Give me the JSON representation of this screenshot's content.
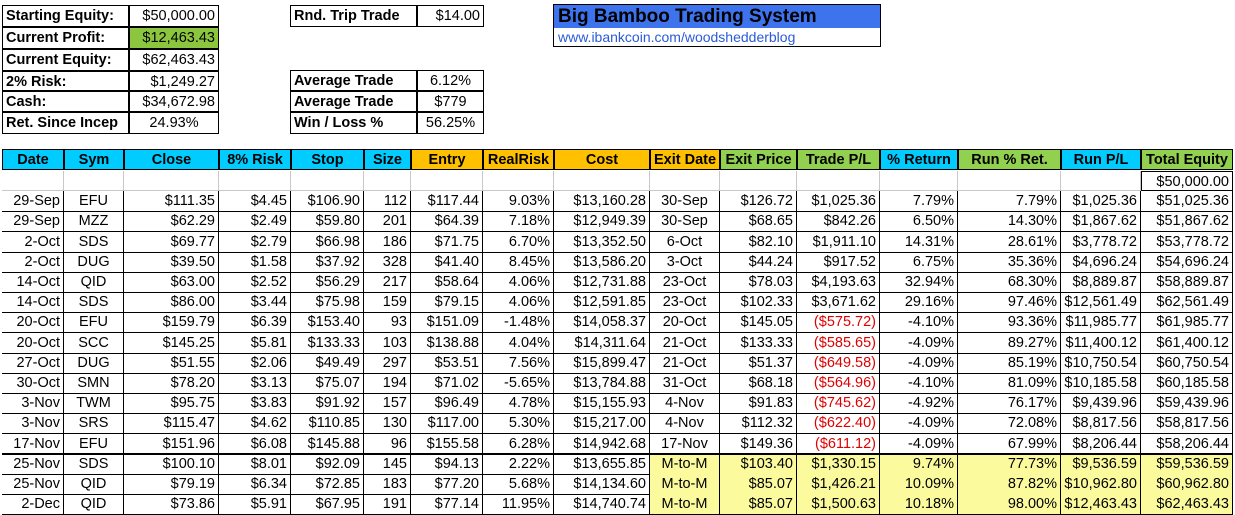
{
  "title": {
    "heading": "Big Bamboo Trading System",
    "link": "www.ibankcoin.com/woodshedderblog"
  },
  "summary": {
    "starting_equity": {
      "label": "Starting Equity:",
      "value": "$50,000.00"
    },
    "current_profit": {
      "label": "Current Profit:",
      "value": "$12,463.43"
    },
    "current_equity": {
      "label": "Current Equity:",
      "value": "$62,463.43"
    },
    "risk_2pct": {
      "label": "2% Risk:",
      "value": "$1,249.27"
    },
    "cash": {
      "label": "Cash:",
      "value": "$34,672.98"
    },
    "ret_since_incep": {
      "label": "Ret. Since Incep",
      "value": "24.93%"
    },
    "rnd_trip_trade": {
      "label": "Rnd. Trip Trade",
      "value": "$14.00"
    },
    "avg_trade_pct": {
      "label": "Average Trade",
      "value": "6.12%"
    },
    "avg_trade_usd": {
      "label": "Average Trade",
      "value": "$779"
    },
    "win_loss": {
      "label": "Win / Loss %",
      "value": "56.25%"
    }
  },
  "columns": [
    "Date",
    "Sym",
    "Close",
    "8% Risk",
    "Stop",
    "Size",
    "Entry",
    "RealRisk",
    "Cost",
    "Exit Date",
    "Exit Price",
    "Trade P/L",
    "% Return",
    "Run % Ret.",
    "Run P/L",
    "Total Equity"
  ],
  "starting_total_equity": "$50,000.00",
  "rows": [
    [
      "29-Sep",
      "EFU",
      "$111.35",
      "$4.45",
      "$106.90",
      "112",
      "$117.44",
      "9.03%",
      "$13,160.28",
      "30-Sep",
      "$126.72",
      "$1,025.36",
      "7.79%",
      "7.79%",
      "$1,025.36",
      "$51,025.36"
    ],
    [
      "29-Sep",
      "MZZ",
      "$62.29",
      "$2.49",
      "$59.80",
      "201",
      "$64.39",
      "7.18%",
      "$12,949.39",
      "30-Sep",
      "$68.65",
      "$842.26",
      "6.50%",
      "14.30%",
      "$1,867.62",
      "$51,867.62"
    ],
    [
      "2-Oct",
      "SDS",
      "$69.77",
      "$2.79",
      "$66.98",
      "186",
      "$71.75",
      "6.70%",
      "$13,352.50",
      "6-Oct",
      "$82.10",
      "$1,911.10",
      "14.31%",
      "28.61%",
      "$3,778.72",
      "$53,778.72"
    ],
    [
      "2-Oct",
      "DUG",
      "$39.50",
      "$1.58",
      "$37.92",
      "328",
      "$41.40",
      "8.45%",
      "$13,586.20",
      "3-Oct",
      "$44.24",
      "$917.52",
      "6.75%",
      "35.36%",
      "$4,696.24",
      "$54,696.24"
    ],
    [
      "14-Oct",
      "QID",
      "$63.00",
      "$2.52",
      "$56.29",
      "217",
      "$58.64",
      "4.06%",
      "$12,731.88",
      "23-Oct",
      "$78.03",
      "$4,193.63",
      "32.94%",
      "68.30%",
      "$8,889.87",
      "$58,889.87"
    ],
    [
      "14-Oct",
      "SDS",
      "$86.00",
      "$3.44",
      "$75.98",
      "159",
      "$79.15",
      "4.06%",
      "$12,591.85",
      "23-Oct",
      "$102.33",
      "$3,671.62",
      "29.16%",
      "97.46%",
      "$12,561.49",
      "$62,561.49"
    ],
    [
      "20-Oct",
      "EFU",
      "$159.79",
      "$6.39",
      "$153.40",
      "93",
      "$151.09",
      "-1.48%",
      "$14,058.37",
      "20-Oct",
      "$145.05",
      "($575.72)",
      "-4.10%",
      "93.36%",
      "$11,985.77",
      "$61,985.77"
    ],
    [
      "20-Oct",
      "SCC",
      "$145.25",
      "$5.81",
      "$133.33",
      "103",
      "$138.88",
      "4.04%",
      "$14,311.64",
      "21-Oct",
      "$133.33",
      "($585.65)",
      "-4.09%",
      "89.27%",
      "$11,400.12",
      "$61,400.12"
    ],
    [
      "27-Oct",
      "DUG",
      "$51.55",
      "$2.06",
      "$49.49",
      "297",
      "$53.51",
      "7.56%",
      "$15,899.47",
      "21-Oct",
      "$51.37",
      "($649.58)",
      "-4.09%",
      "85.19%",
      "$10,750.54",
      "$60,750.54"
    ],
    [
      "30-Oct",
      "SMN",
      "$78.20",
      "$3.13",
      "$75.07",
      "194",
      "$71.02",
      "-5.65%",
      "$13,784.88",
      "31-Oct",
      "$68.18",
      "($564.96)",
      "-4.10%",
      "81.09%",
      "$10,185.58",
      "$60,185.58"
    ],
    [
      "3-Nov",
      "TWM",
      "$95.75",
      "$3.83",
      "$91.92",
      "157",
      "$96.49",
      "4.78%",
      "$15,155.93",
      "4-Nov",
      "$91.83",
      "($745.62)",
      "-4.92%",
      "76.17%",
      "$9,439.96",
      "$59,439.96"
    ],
    [
      "3-Nov",
      "SRS",
      "$115.47",
      "$4.62",
      "$110.85",
      "130",
      "$117.00",
      "5.30%",
      "$15,217.00",
      "4-Nov",
      "$112.32",
      "($622.40)",
      "-4.09%",
      "72.08%",
      "$8,817.56",
      "$58,817.56"
    ],
    [
      "17-Nov",
      "EFU",
      "$151.96",
      "$6.08",
      "$145.88",
      "96",
      "$155.58",
      "6.28%",
      "$14,942.68",
      "17-Nov",
      "$149.36",
      "($611.12)",
      "-4.09%",
      "67.99%",
      "$8,206.44",
      "$58,206.44"
    ]
  ],
  "open_rows": [
    [
      "25-Nov",
      "SDS",
      "$100.10",
      "$8.01",
      "$92.09",
      "145",
      "$94.13",
      "2.22%",
      "$13,655.85",
      "M-to-M",
      "$103.40",
      "$1,330.15",
      "9.74%",
      "77.73%",
      "$9,536.59",
      "$59,536.59"
    ],
    [
      "25-Nov",
      "QID",
      "$79.19",
      "$6.34",
      "$72.85",
      "183",
      "$77.20",
      "5.68%",
      "$14,134.60",
      "M-to-M",
      "$85.07",
      "$1,426.21",
      "10.09%",
      "87.82%",
      "$10,962.80",
      "$60,962.80"
    ],
    [
      "2-Dec",
      "QID",
      "$73.86",
      "$5.91",
      "$67.95",
      "191",
      "$77.14",
      "11.95%",
      "$14,740.74",
      "M-to-M",
      "$85.07",
      "$1,500.63",
      "10.18%",
      "98.00%",
      "$12,463.43",
      "$62,463.43"
    ]
  ],
  "colors": {
    "header_cyan": "#00ccff",
    "header_orange": "#ffc000",
    "header_green": "#92d050",
    "profit_green": "#8bc63e",
    "title_blue": "#3d74ee",
    "mtm_yellow": "#fbfb9e",
    "negative_red": "#e00000"
  }
}
